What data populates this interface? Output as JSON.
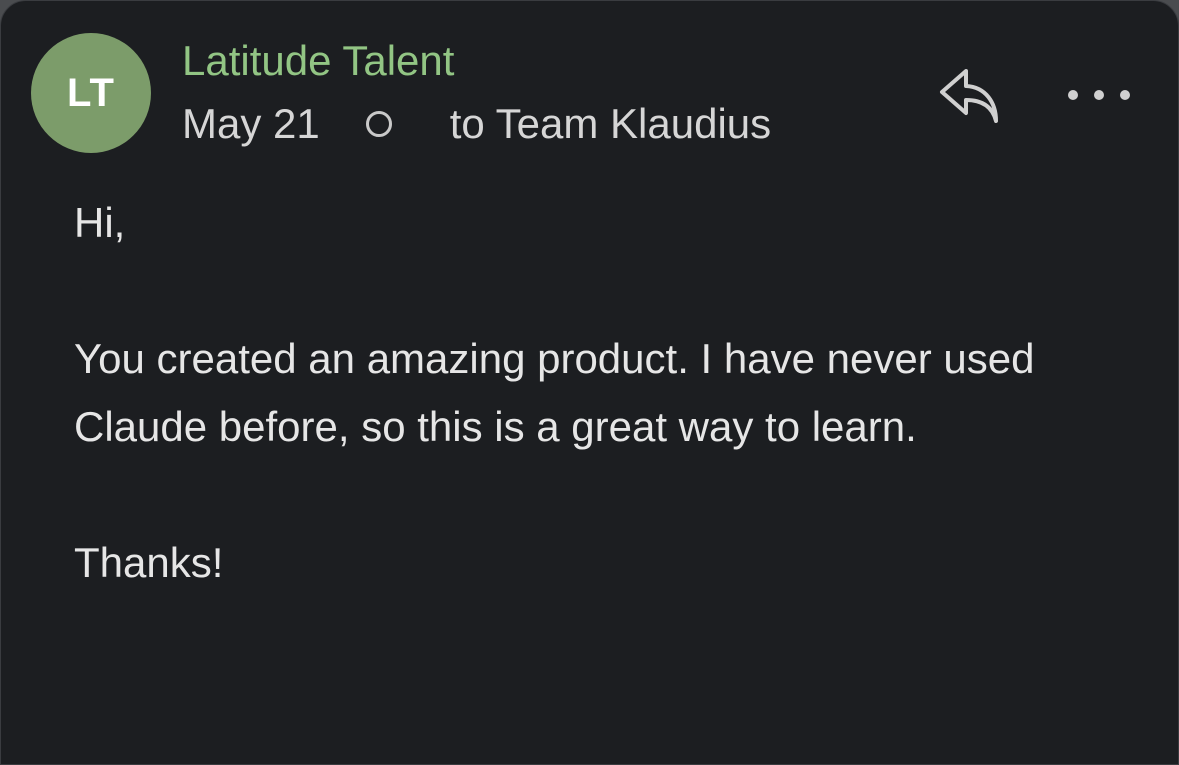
{
  "email": {
    "avatar_initials": "LT",
    "sender_name": "Latitude Talent",
    "date": "May 21",
    "recipient": "to Team Klaudius",
    "body_paragraphs": [
      "Hi,",
      "You created an amazing product. I have never used Claude before, so this is a great way to learn.",
      "Thanks!"
    ]
  },
  "actions": {
    "reply_icon": "reply-icon",
    "more_icon": "more-options-icon"
  },
  "colors": {
    "avatar_bg": "#7c9c6a",
    "sender_name": "#92c584",
    "card_bg": "#1c1e21",
    "icon": "#d0d0d0"
  }
}
